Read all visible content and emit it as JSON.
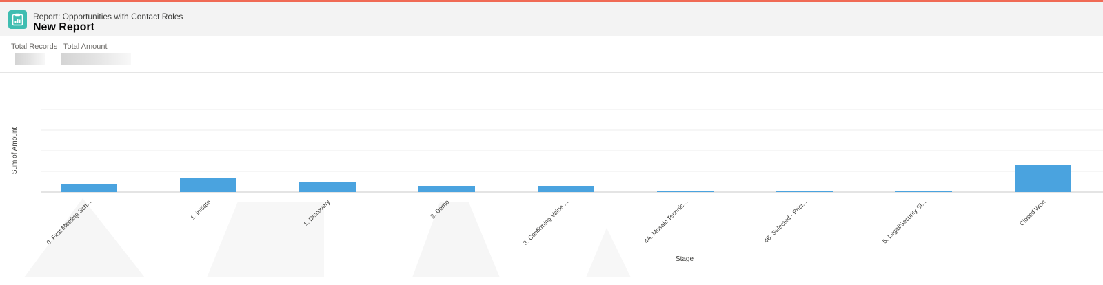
{
  "header": {
    "subtitle": "Report: Opportunities with Contact Roles",
    "title": "New Report",
    "icon": "report-icon"
  },
  "summary": {
    "total_records_label": "Total Records",
    "total_amount_label": "Total Amount"
  },
  "colors": {
    "accent": "#f06a55",
    "icon_bg": "#3fbdb1",
    "bar": "#4aa3df"
  },
  "chart_data": {
    "type": "bar",
    "categories": [
      "0. First Meeting Sch...",
      "1. Initiate",
      "1. Discovery",
      "2. Demo",
      "3. Confirming Value ...",
      "4A. Mosaic Technic...",
      "4B. Selected - Prici...",
      "5. Legal/Security Si...",
      "Closed Won"
    ],
    "values": [
      0.37,
      0.67,
      0.47,
      0.3,
      0.3,
      0.05,
      0.06,
      0.02,
      1.33
    ],
    "xlabel": "Stage",
    "ylabel": "Sum of Amount",
    "ylim": [
      0,
      4
    ],
    "grid": true,
    "legend": "none"
  }
}
